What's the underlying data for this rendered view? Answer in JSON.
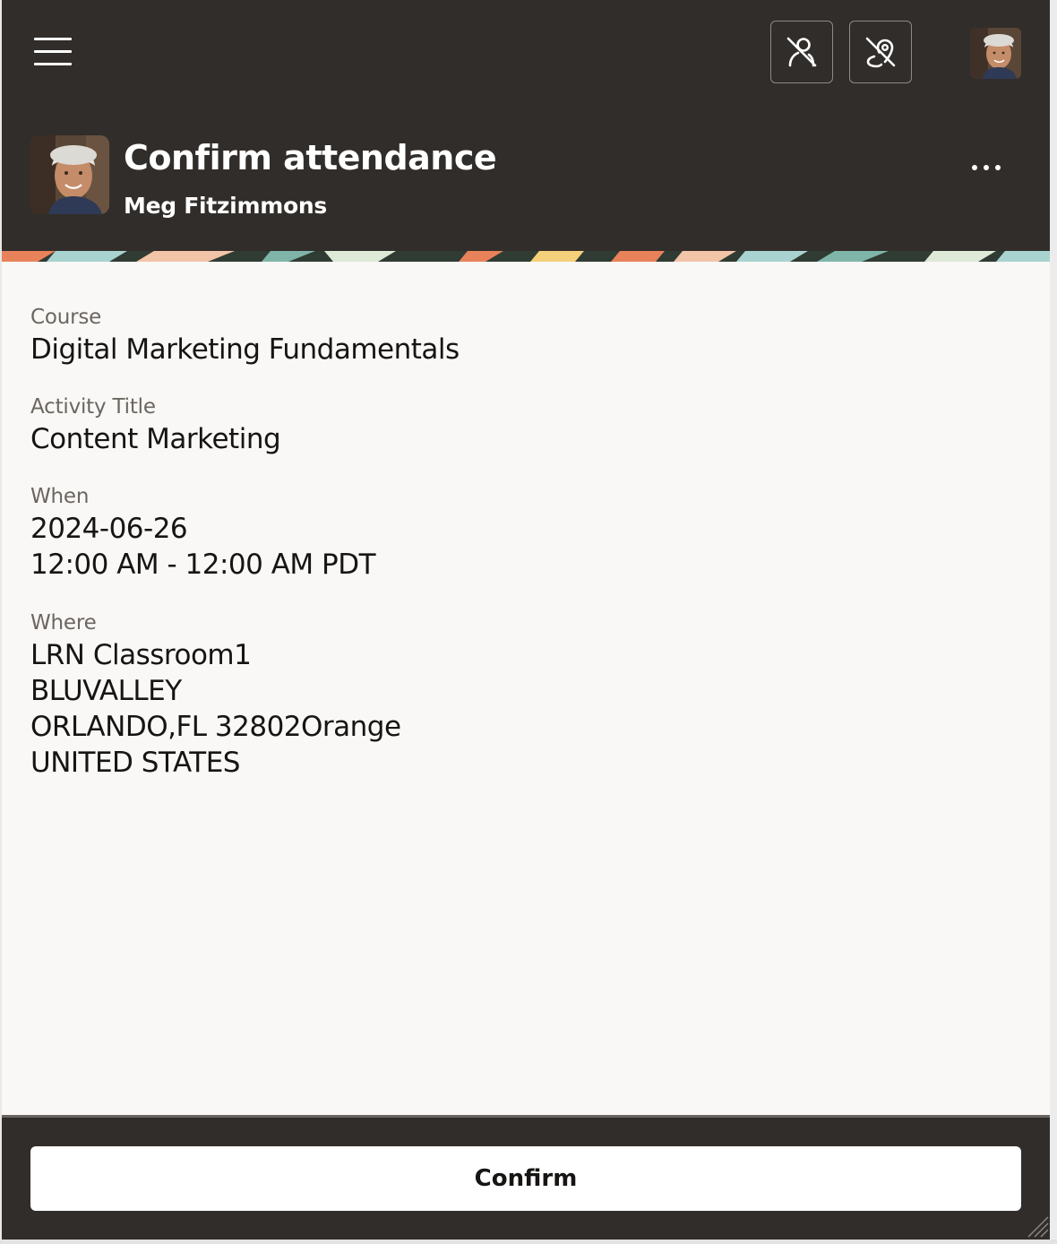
{
  "header": {
    "menu_icon": "hamburger-menu-icon",
    "tool_buttons": [
      {
        "icon": "person-off-icon"
      },
      {
        "icon": "location-off-icon"
      }
    ],
    "profile_avatar": "user-avatar",
    "title": "Confirm attendance",
    "subtitle": "Meg Fitzimmons",
    "more_icon": "more-horizontal-icon"
  },
  "details": {
    "course": {
      "label": "Course",
      "value": "Digital Marketing Fundamentals"
    },
    "activity": {
      "label": "Activity Title",
      "value": "Content Marketing"
    },
    "when": {
      "label": "When",
      "date": "2024-06-26",
      "time": "12:00 AM - 12:00 AM PDT"
    },
    "where": {
      "label": "Where",
      "lines": [
        "LRN Classroom1",
        "BLUVALLEY",
        "ORLANDO,FL 32802Orange",
        "UNITED STATES"
      ]
    }
  },
  "footer": {
    "confirm_label": "Confirm"
  },
  "colors": {
    "header_bg": "#312d2a",
    "content_bg": "#f9f8f6",
    "label_text": "#6b6661",
    "value_text": "#161513"
  }
}
